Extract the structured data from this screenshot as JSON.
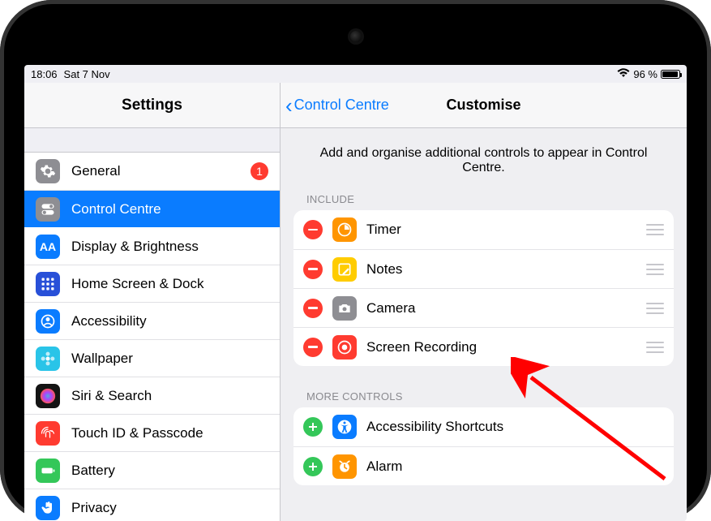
{
  "status": {
    "time": "18:06",
    "date": "Sat 7 Nov",
    "battery_pct": "96 %",
    "battery_fill_pct": 96
  },
  "sidebar": {
    "title": "Settings",
    "items": [
      {
        "label": "General",
        "icon": "gear-icon",
        "color": "#8e8e93",
        "badge": "1"
      },
      {
        "label": "Control Centre",
        "icon": "toggle-icon",
        "color": "#8e8e93",
        "selected": true
      },
      {
        "label": "Display & Brightness",
        "icon": "aa-icon",
        "color": "#0a7cff"
      },
      {
        "label": "Home Screen & Dock",
        "icon": "grid-icon",
        "color": "#2850d8"
      },
      {
        "label": "Accessibility",
        "icon": "person-icon",
        "color": "#0a7cff"
      },
      {
        "label": "Wallpaper",
        "icon": "flower-icon",
        "color": "#29c4e8"
      },
      {
        "label": "Siri & Search",
        "icon": "siri-icon",
        "color": "#141414"
      },
      {
        "label": "Touch ID & Passcode",
        "icon": "fingerprint-icon",
        "color": "#ff3b30"
      },
      {
        "label": "Battery",
        "icon": "battery-icon",
        "color": "#34c759"
      },
      {
        "label": "Privacy",
        "icon": "hand-icon",
        "color": "#0a7cff"
      }
    ]
  },
  "detail": {
    "back_label": "Control Centre",
    "title": "Customise",
    "intro": "Add and organise additional controls to appear in Control Centre.",
    "include_label": "INCLUDE",
    "include": [
      {
        "label": "Timer",
        "icon": "timer-icon",
        "color": "#ff9500"
      },
      {
        "label": "Notes",
        "icon": "notes-icon",
        "color": "#ffcc00"
      },
      {
        "label": "Camera",
        "icon": "camera-icon",
        "color": "#8e8e93"
      },
      {
        "label": "Screen Recording",
        "icon": "record-icon",
        "color": "#ff3b30"
      }
    ],
    "more_label": "MORE CONTROLS",
    "more": [
      {
        "label": "Accessibility Shortcuts",
        "icon": "accessibility-icon",
        "color": "#0a7cff"
      },
      {
        "label": "Alarm",
        "icon": "alarm-icon",
        "color": "#ff9500"
      }
    ]
  }
}
